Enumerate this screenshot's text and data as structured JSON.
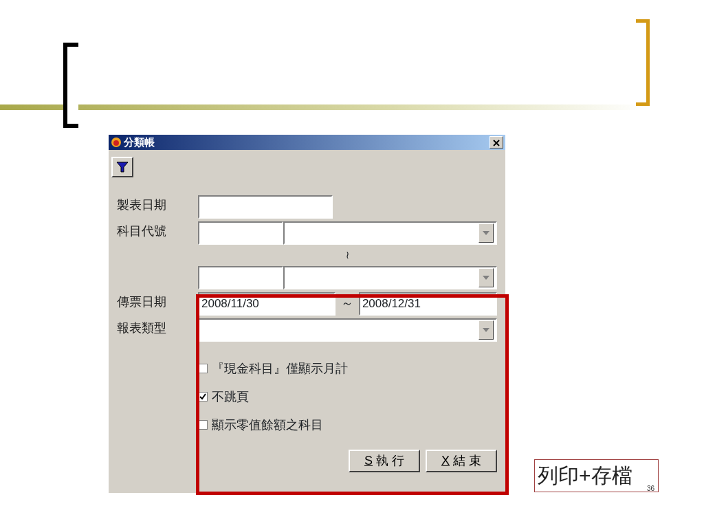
{
  "dialog": {
    "title": "分類帳",
    "report_date": {
      "label": "製表日期"
    },
    "account_code": {
      "label": "科目代號",
      "range_mark": "≀"
    },
    "voucher_date": {
      "label": "傳票日期",
      "from": "2008/11/30",
      "separator": "～",
      "to": "2008/12/31"
    },
    "report_type": {
      "label": "報表類型"
    },
    "options": [
      {
        "label": "『現金科目』僅顯示月計",
        "checked": false
      },
      {
        "label": "不跳頁",
        "checked": true
      },
      {
        "label": "顯示零值餘額之科目",
        "checked": false
      }
    ],
    "buttons": [
      {
        "hotkey": "S",
        "label": "執 行"
      },
      {
        "hotkey": "X",
        "label": "結 束"
      }
    ]
  },
  "slide": {
    "caption": "列印+存檔",
    "page_number": "36"
  }
}
